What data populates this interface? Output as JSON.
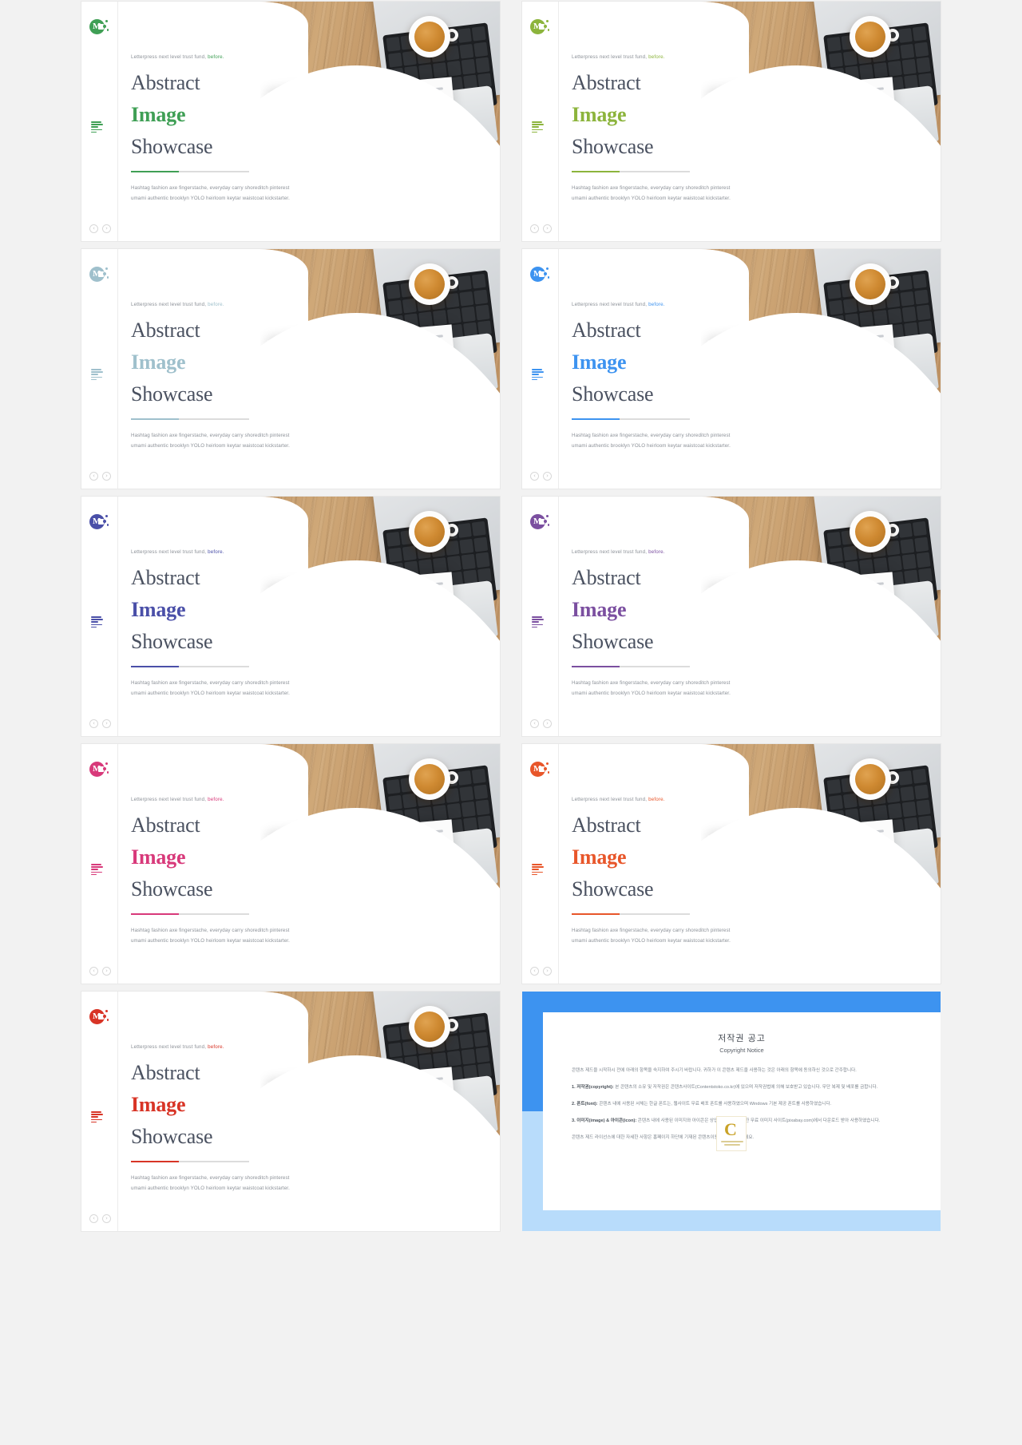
{
  "common": {
    "eyebrow_prefix": "Letterpress next level trust fund,",
    "eyebrow_suffix": "before.",
    "title_line1": "Abstract",
    "title_line2": "Image",
    "title_line3": "Showcase",
    "paragraph_line1": "Hashtag fashion axe fingerstache, everyday carry shoreditch pinterest",
    "paragraph_line2": "umami authentic brooklyn YOLO heirloom keytar waistcoat kickstarter.",
    "logo_letter": "M",
    "nav_prev": "‹",
    "nav_next": "›",
    "stamp_letter": "C"
  },
  "slides": [
    {
      "id": "slide-1",
      "accent": "#3f9f55",
      "accent_name": "green"
    },
    {
      "id": "slide-2",
      "accent": "#8cb43c",
      "accent_name": "yellow-green"
    },
    {
      "id": "slide-3",
      "accent": "#9fc0cc",
      "accent_name": "pale-blue"
    },
    {
      "id": "slide-4",
      "accent": "#3d93f0",
      "accent_name": "blue"
    },
    {
      "id": "slide-5",
      "accent": "#4a4fa8",
      "accent_name": "indigo"
    },
    {
      "id": "slide-6",
      "accent": "#7b4fa0",
      "accent_name": "purple"
    },
    {
      "id": "slide-7",
      "accent": "#d8397a",
      "accent_name": "pink"
    },
    {
      "id": "slide-8",
      "accent": "#e8562a",
      "accent_name": "orange"
    },
    {
      "id": "slide-9",
      "accent": "#d83426",
      "accent_name": "red"
    }
  ],
  "copyright": {
    "title_ko": "저작권 공고",
    "title_en": "Copyright Notice",
    "intro": "콘텐츠 제드을 시작하시 전에 아래의 항목을 숙지하여 주시기 바랍니다. 귀하가 이 콘텐츠 제드을 사용하는 것은 아래의 항목에 동의하신 것으로 간주합니다.",
    "items": [
      {
        "heading": "1. 저작권(copyright):",
        "body": "본 콘텐츠의 소유 및 저작권은 콘텐츠사이트(Contentstoko.co.kr)에 있으며 저작권법에 의해 보호받고 있습니다. 무단 복제 및 배포를 금합니다."
      },
      {
        "heading": "2. 폰트(font):",
        "body": "콘텐츠 내에 사용된 서체는 한글 폰트는, 웹사이트 무료 배포 폰트를 사용하였으며 Windows 기본 제공 폰트를 사용하였습니다."
      },
      {
        "heading": "3. 이미지(image) & 아이콘(icon):",
        "body": "콘텐츠 내에 사용된 이미지와 아이콘은 상업적 이용이 가능한 무료 이미지 사이트(pixabay.com)에서 다운로드 받아 사용하였습니다."
      }
    ],
    "outro": "콘텐츠 제드 라이선스에 대한 자세한 사항은 홈페이지 하단에 기재된 콘텐츠이용안내를 참고하세요.",
    "seal_letter": "C"
  }
}
